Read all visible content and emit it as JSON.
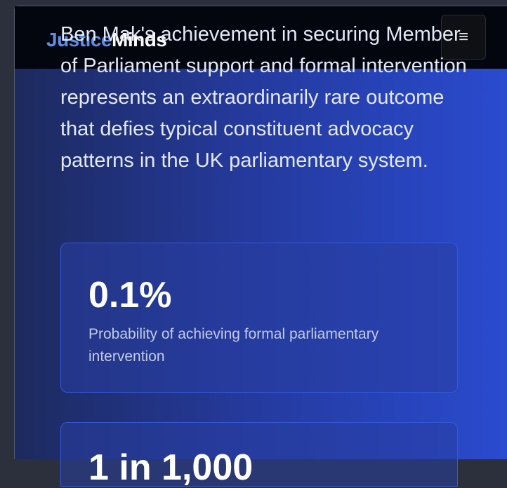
{
  "nav": {
    "brand_first": "Justice",
    "brand_second": "Minds",
    "menu_icon": "hamburger-icon"
  },
  "lead": "Ben Mak's achievement in securing Member of Parliament support and formal intervention represents an extraordinarily rare outcome that defies typical constituent advocacy patterns in the UK parliamentary system.",
  "stats": [
    {
      "value": "0.1%",
      "label": "Probability of achieving formal parliamentary intervention"
    },
    {
      "value": "1 in 1,000",
      "label": ""
    }
  ]
}
